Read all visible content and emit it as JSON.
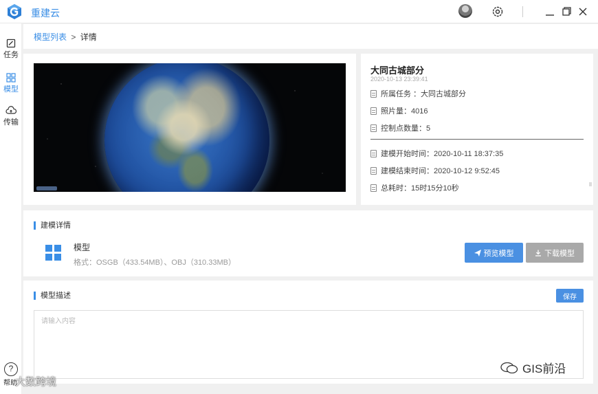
{
  "app": {
    "title": "重建云"
  },
  "titlebar": {
    "icons": [
      "avatar",
      "gear-icon",
      "minimize-icon",
      "maximize-icon",
      "close-icon"
    ]
  },
  "sidenav": {
    "items": [
      {
        "label": "任务",
        "icon": "task-icon",
        "active": false
      },
      {
        "label": "模型",
        "icon": "model-grid-icon",
        "active": true
      },
      {
        "label": "传输",
        "icon": "cloud-upload-icon",
        "active": false
      }
    ],
    "help_label": "帮助"
  },
  "breadcrumb": {
    "parent": "模型列表",
    "separator": ">",
    "current": "详情"
  },
  "info": {
    "title": "大同古城部分",
    "date": "2020-10-13 23:39:41",
    "task": "所属任务 ：大同古城部分",
    "photos": "照片量：4016",
    "control_points": "控制点数量：5",
    "start_time": "建模开始时间：2020-10-11 18:37:35",
    "end_time": "建模结束时间：2020-10-12 9:52:45",
    "duration": "总耗时：15时15分10秒"
  },
  "detail": {
    "section_title": "建模详情",
    "model_name": "模型",
    "format": "格式：OSGB（433.54MB）、OBJ（310.33MB）",
    "preview_button": "预览模型",
    "download_button": "下载模型"
  },
  "description": {
    "section_title": "模型描述",
    "save_button": "保存",
    "placeholder": "请输入内容",
    "value": ""
  },
  "watermarks": {
    "left": "大数跨境",
    "right": "GIS前沿"
  },
  "colors": {
    "accent": "#3a8ee6",
    "button_primary": "#4a90e2",
    "button_disabled": "#a9a9a9"
  }
}
